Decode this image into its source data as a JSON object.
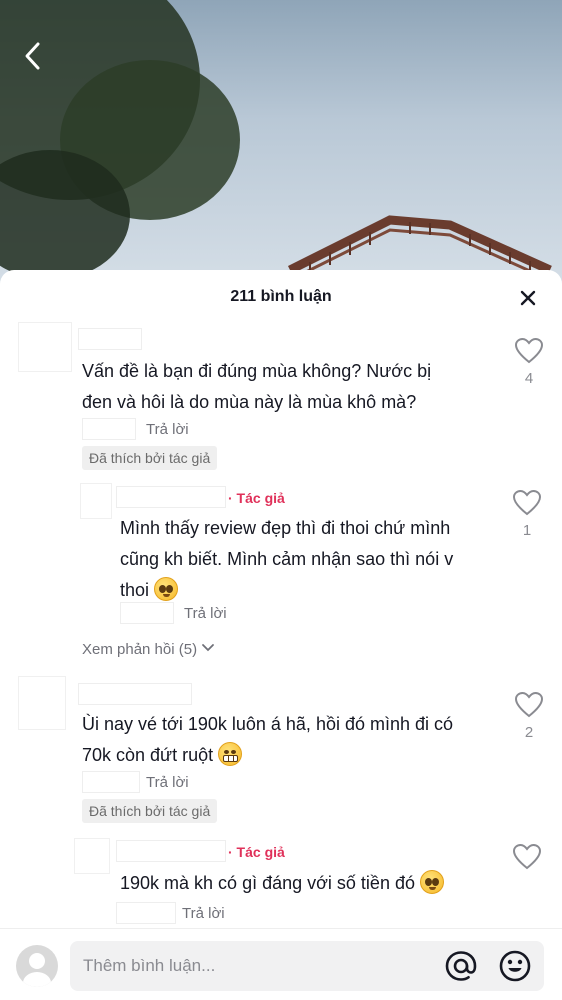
{
  "video": {
    "back_icon": "chevron-left-icon"
  },
  "sheet": {
    "title": "211 bình luận",
    "close_icon": "close-icon"
  },
  "comments": [
    {
      "text_lines": [
        "Vấn đề là bạn đi đúng mùa không? Nước bị",
        "đen và hôi là do mùa này là mùa khô mà?"
      ],
      "reply_label": "Trả lời",
      "liked_badge": "Đã thích bởi tác giả",
      "like_count": "4",
      "reply": {
        "author_tag": "· Tác giả",
        "text_lines": [
          "Mình thấy review đẹp thì đi thoi chứ mình",
          "cũng kh biết. Mình cảm nhận sao thì nói v",
          "thoi"
        ],
        "emoji": "pleading-face",
        "reply_label": "Trả lời",
        "like_count": "1"
      },
      "view_replies": "Xem phản hồi (5)"
    },
    {
      "text_lines": [
        "Ùi nay vé tới 190k luôn á hã, hồi đó mình đi có",
        "70k còn đứt ruột"
      ],
      "emoji": "grimacing-face",
      "reply_label": "Trả lời",
      "liked_badge": "Đã thích bởi tác giả",
      "like_count": "2",
      "reply": {
        "author_tag": "· Tác giả",
        "text_lines": [
          "190k mà kh có gì đáng với số tiền đó"
        ],
        "emoji": "pleading-face",
        "reply_label": "Trả lời",
        "like_count": ""
      }
    }
  ],
  "bottom_bar": {
    "placeholder": "Thêm bình luận...",
    "at_icon": "at-mention-icon",
    "emoji_icon": "emoji-icon"
  }
}
